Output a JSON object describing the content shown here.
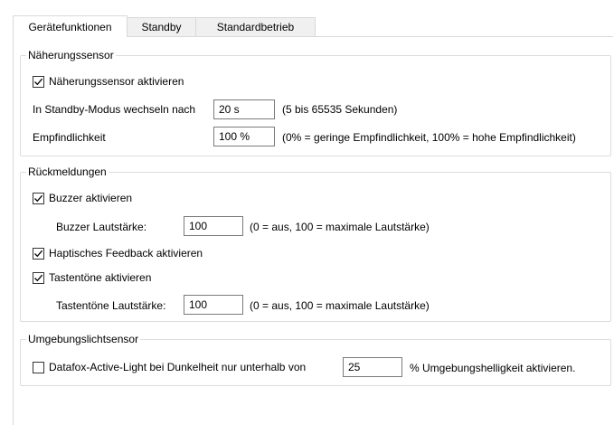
{
  "tabs": [
    {
      "label": "Gerätefunktionen",
      "active": true
    },
    {
      "label": "Standby",
      "active": false
    },
    {
      "label": "Standardbetrieb",
      "active": false
    }
  ],
  "proximity": {
    "title": "Näherungssensor",
    "enable_label": "Näherungssensor aktivieren",
    "enable_checked": true,
    "standby_label": "In Standby-Modus wechseln nach",
    "standby_value": "20   s",
    "standby_hint": "(5 bis 65535 Sekunden)",
    "sensitivity_label": "Empfindlichkeit",
    "sensitivity_value": "100 %",
    "sensitivity_hint": "(0% = geringe Empfindlichkeit, 100% = hohe Empfindlichkeit)"
  },
  "feedback": {
    "title": "Rückmeldungen",
    "buzzer_label": "Buzzer aktivieren",
    "buzzer_checked": true,
    "buzzer_volume_label": "Buzzer Lautstärke:",
    "buzzer_volume_value": "100",
    "buzzer_volume_hint": "(0 = aus, 100 = maximale Lautstärke)",
    "haptic_label": "Haptisches Feedback aktivieren",
    "haptic_checked": true,
    "keytone_label": "Tastentöne aktivieren",
    "keytone_checked": true,
    "keytone_volume_label": "Tastentöne Lautstärke:",
    "keytone_volume_value": "100",
    "keytone_volume_hint": "(0 = aus, 100 = maximale Lautstärke)"
  },
  "ambient": {
    "title": "Umgebungslichtsensor",
    "active_light_label": "Datafox-Active-Light bei Dunkelheit nur unterhalb von",
    "active_light_checked": false,
    "threshold_value": "25",
    "threshold_suffix": "% Umgebungshelligkeit aktivieren."
  }
}
